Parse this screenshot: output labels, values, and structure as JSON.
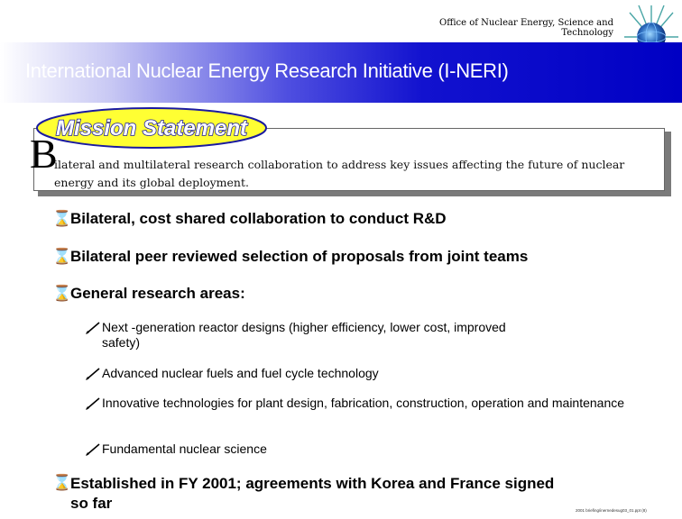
{
  "header": {
    "office": "Office of Nuclear Energy, Science and Technology",
    "title": "International Nuclear Energy Research Initiative (I-NERI)"
  },
  "mission": {
    "badge": "Mission Statement",
    "dropcap": "B",
    "text": "ilateral and multilateral research collaboration to address key issues affecting the future of nuclear energy and its global deployment."
  },
  "bullets": [
    {
      "text": "Bilateral, cost shared collaboration to conduct R&D",
      "icon": "hourglass-icon"
    },
    {
      "text": "Bilateral peer reviewed selection of proposals from joint teams",
      "icon": "hourglass-icon"
    },
    {
      "text": "General research areas:",
      "icon": "hourglass-icon"
    },
    {
      "text": "Established in FY 2001; agreements with Korea and France signed so far",
      "icon": "hourglass-icon"
    }
  ],
  "subitems": [
    {
      "text": "Next -generation reactor designs (higher efficiency, lower cost, improved safety)",
      "icon": "pencil-icon"
    },
    {
      "text": "Advanced nuclear fuels and fuel cycle technology",
      "icon": "pencil-icon"
    },
    {
      "text": "Innovative technologies for plant design, fabrication, construction, operation and maintenance",
      "icon": "pencil-icon"
    },
    {
      "text": "Fundamental nuclear science",
      "icon": "pencil-icon"
    }
  ],
  "footer": "2001 briefing/inernedesug03_01.ppt (8)",
  "colors": {
    "banner": "#0000c4",
    "badge_fill": "#ffff33",
    "badge_text": "#1a1aa0"
  }
}
